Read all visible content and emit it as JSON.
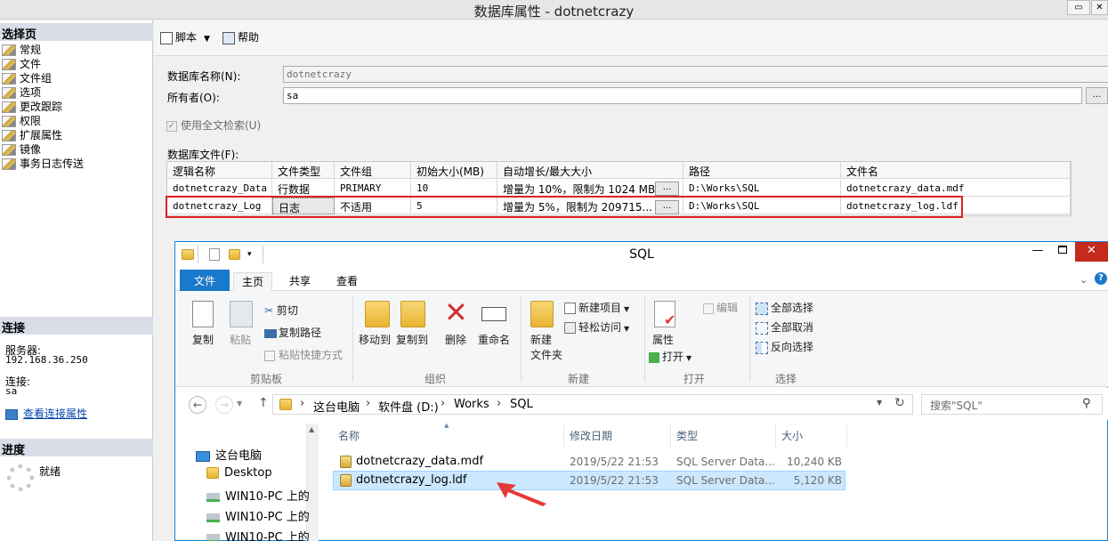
{
  "dialog": {
    "title": "数据库属性 - dotnetcrazy",
    "select_page_header": "选择页",
    "pages": [
      "常规",
      "文件",
      "文件组",
      "选项",
      "更改跟踪",
      "权限",
      "扩展属性",
      "镜像",
      "事务日志传送"
    ],
    "connection": {
      "header": "连接",
      "server_label": "服务器:",
      "server_value": "192.168.36.250",
      "conn_label": "连接:",
      "conn_value": "sa",
      "view_props_link": "查看连接属性"
    },
    "progress": {
      "header": "进度",
      "status": "就绪"
    },
    "toolbar": {
      "script_label": "脚本",
      "help_label": "帮助"
    },
    "db_name_label": "数据库名称(N):",
    "db_name_value": "dotnetcrazy",
    "owner_label": "所有者(O):",
    "owner_value": "sa",
    "fulltext_label": "使用全文检索(U)",
    "files_label": "数据库文件(F):",
    "grid": {
      "headers": [
        "逻辑名称",
        "文件类型",
        "文件组",
        "初始大小(MB)",
        "自动增长/最大大小",
        "路径",
        "文件名"
      ],
      "rows": [
        [
          "dotnetcrazy_Data",
          "行数据",
          "PRIMARY",
          "10",
          "增量为 10%，限制为 1024 MB",
          "D:\\Works\\SQL",
          "dotnetcrazy_data.mdf"
        ],
        [
          "dotnetcrazy_Log",
          "日志",
          "不适用",
          "5",
          "增量为 5%，限制为 209715...",
          "D:\\Works\\SQL",
          "dotnetcrazy_log.ldf"
        ]
      ],
      "ellipsis": "..."
    }
  },
  "explorer": {
    "title": "SQL",
    "tabs": [
      "文件",
      "主页",
      "共享",
      "查看"
    ],
    "clipboard": {
      "copy": "复制",
      "paste": "粘贴",
      "cut": "剪切",
      "copy_path": "复制路径",
      "paste_shortcut": "粘贴快捷方式",
      "group": "剪贴板"
    },
    "organize": {
      "move_to": "移动到",
      "copy_to": "复制到",
      "delete": "删除",
      "rename": "重命名",
      "group": "组织"
    },
    "new": {
      "new_folder_1": "新建",
      "new_folder_2": "文件夹",
      "new_item": "新建项目",
      "easy_access": "轻松访问",
      "group": "新建"
    },
    "open": {
      "properties": "属性",
      "open": "打开",
      "edit": "编辑",
      "group": "打开"
    },
    "select": {
      "select_all": "全部选择",
      "select_none": "全部取消",
      "invert": "反向选择",
      "group": "选择"
    },
    "breadcrumb": [
      "这台电脑",
      "软件盘 (D:)",
      "Works",
      "SQL"
    ],
    "search_placeholder": "搜索\"SQL\"",
    "nav": [
      "这台电脑",
      "Desktop",
      "WIN10-PC 上的",
      "WIN10-PC 上的",
      "WIN10-PC 上的"
    ],
    "columns": [
      "名称",
      "修改日期",
      "类型",
      "大小"
    ],
    "files": [
      {
        "name": "dotnetcrazy_data.mdf",
        "date": "2019/5/22 21:53",
        "type": "SQL Server Data...",
        "size": "10,240 KB"
      },
      {
        "name": "dotnetcrazy_log.ldf",
        "date": "2019/5/22 21:53",
        "type": "SQL Server Data...",
        "size": "5,120 KB"
      }
    ]
  },
  "colors": {
    "accent": "#1979ca",
    "highlight_border": "#e02020",
    "selected_row": "#cce8ff"
  }
}
